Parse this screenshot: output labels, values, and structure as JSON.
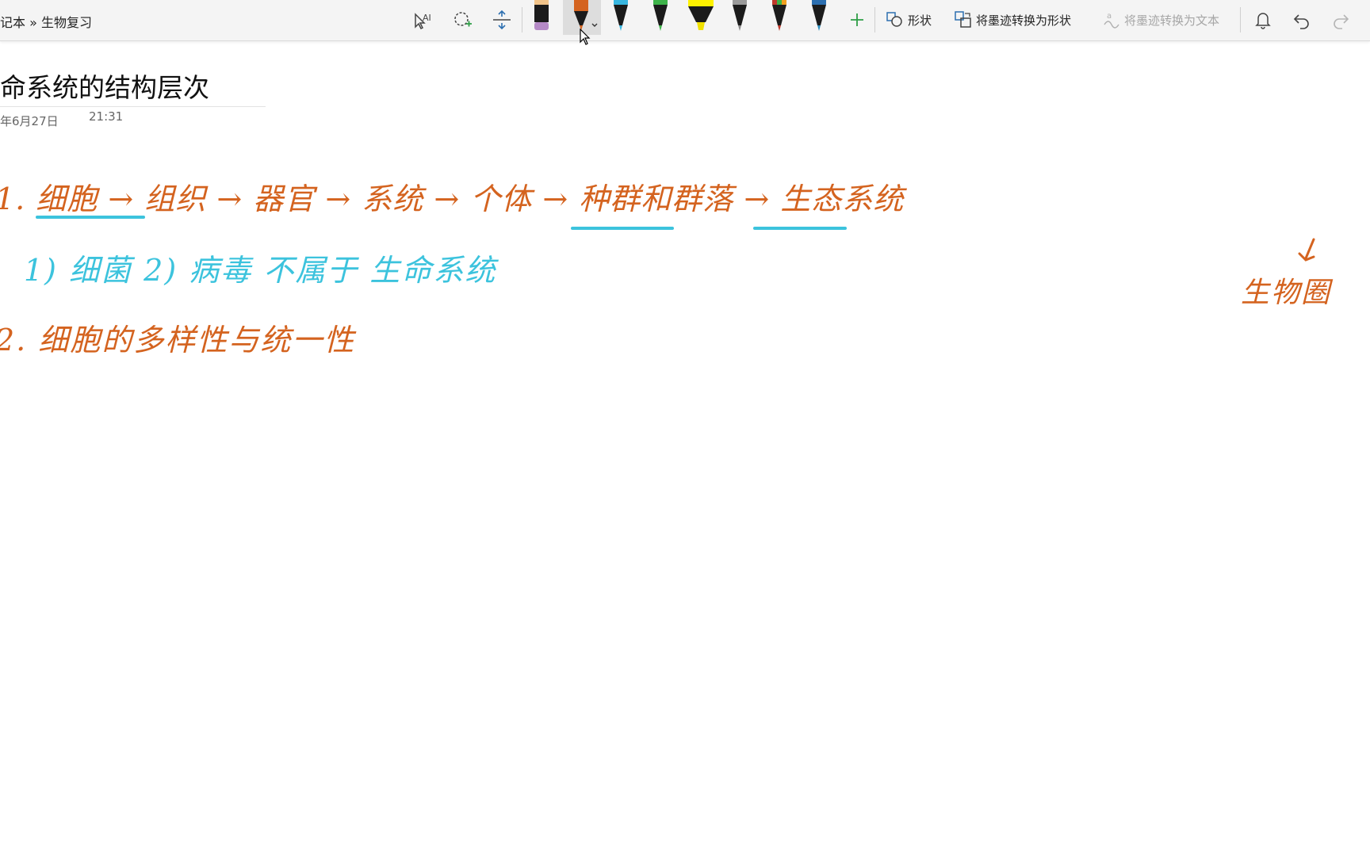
{
  "toolbar": {
    "breadcrumb": "记本 » 生物复习",
    "shapes_label": "形状",
    "ink_to_shape_label": "将墨迹转换为形状",
    "ink_to_text_label": "将墨迹转换为文本",
    "pens": [
      {
        "name": "pen-black-purple",
        "tip": "#b58ac6",
        "body": "#1b1b1b"
      },
      {
        "name": "pen-orange",
        "tip": "#d4631f",
        "body": "#1b1b1b",
        "selected": true
      },
      {
        "name": "pen-cyan",
        "tip": "#38b6e0",
        "body": "#1b1b1b"
      },
      {
        "name": "pen-green",
        "tip": "#3eb34a",
        "body": "#1b1b1b"
      },
      {
        "name": "highlighter-yellow",
        "tip": "#fff200",
        "body": "#f0e000"
      },
      {
        "name": "pencil-gray",
        "tip": "#888888",
        "body": "#1b1b1b"
      },
      {
        "name": "pen-galaxy-red",
        "tip": "#c0392b",
        "body": "#1b1b1b"
      },
      {
        "name": "pen-galaxy-blue",
        "tip": "#2c6fb0",
        "body": "#1b1b1b"
      }
    ]
  },
  "page": {
    "title": "命系统的结构层次",
    "date": "年6月27日",
    "time": "21:31"
  },
  "ink": {
    "line1": "1. 细胞 → 组织 → 器官 → 系统 → 个体 → 种群和群落 → 生态系统",
    "line1_branch": "生物圈",
    "line2": "1) 细菌      2) 病毒 不属于 生命系统",
    "line3": "2. 细胞的多样性与统一性"
  },
  "colors": {
    "ink_orange": "#d4631f",
    "ink_cyan": "#3cc3dd",
    "accent_green": "#2e9e46"
  }
}
